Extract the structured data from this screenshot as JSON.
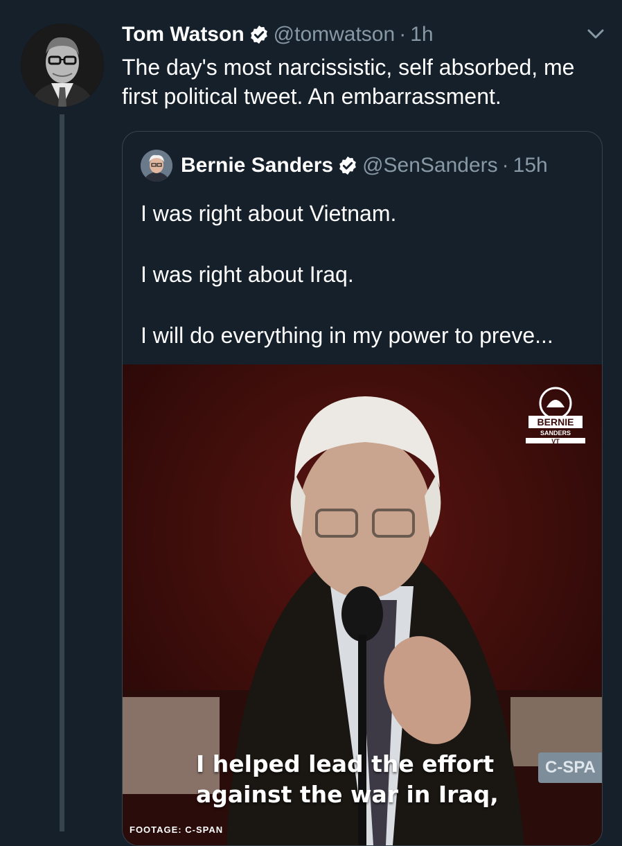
{
  "tweet": {
    "author_name": "Tom Watson",
    "handle": "@tomwatson",
    "separator": "·",
    "time": "1h",
    "text": "The day's most narcissistic, self absorbed, me first political tweet. An embarrassment."
  },
  "quoted_tweet": {
    "author_name": "Bernie Sanders",
    "handle": "@SenSanders",
    "separator": "·",
    "time": "15h",
    "lines": [
      "I was right about Vietnam.",
      "I was right about Iraq.",
      "I will do everything in my power to preve..."
    ],
    "video": {
      "caption_line1": "I helped lead the effort",
      "caption_line2": "against the war in Iraq,",
      "channel_badge": "C-SPA",
      "footage_credit": "FOOTAGE: C-SPAN",
      "logo_top": "BERNIE",
      "logo_middle": "SANDERS",
      "logo_bottom": "VT"
    }
  },
  "icons": {
    "verified": "verified-badge-icon",
    "chevron": "chevron-down-icon"
  },
  "colors": {
    "background": "#15202b",
    "secondary_text": "#8899a6",
    "border": "#38444d"
  }
}
